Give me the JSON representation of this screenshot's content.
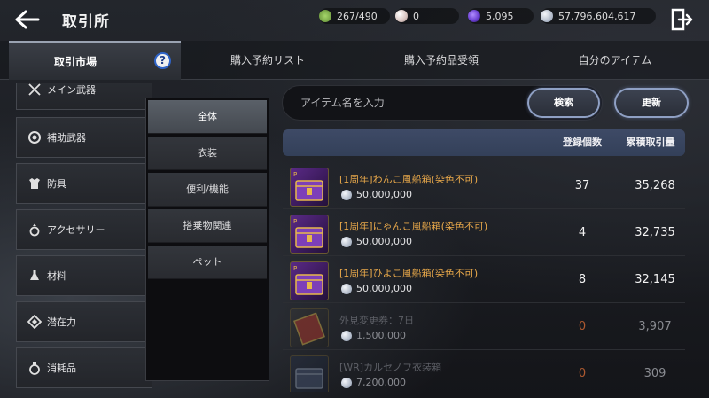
{
  "header": {
    "title": "取引所",
    "resources": [
      {
        "icon": "bag-capacity-icon",
        "value": "267/490",
        "color": "#7fb04a"
      },
      {
        "icon": "pearl-icon",
        "value": "0",
        "color": "#d8c4c0"
      },
      {
        "icon": "energy-orb-icon",
        "value": "5,095",
        "color": "#6a3fd0"
      },
      {
        "icon": "silver-coin-icon",
        "value": "57,796,604,617",
        "color": "#aab4c4"
      }
    ]
  },
  "tabs": [
    {
      "label": "取引市場"
    },
    {
      "label": "購入予約リスト"
    },
    {
      "label": "購入予約品受領"
    },
    {
      "label": "自分のアイテム"
    }
  ],
  "help_label": "?",
  "categories": [
    {
      "label": "メイン武器",
      "icon": "crossed-swords-icon"
    },
    {
      "label": "補助武器",
      "icon": "shield-ring-icon"
    },
    {
      "label": "防具",
      "icon": "armor-icon"
    },
    {
      "label": "アクセサリー",
      "icon": "ring-icon"
    },
    {
      "label": "材料",
      "icon": "flask-icon"
    },
    {
      "label": "潜在力",
      "icon": "diamond-icon"
    },
    {
      "label": "消耗品",
      "icon": "potion-icon"
    }
  ],
  "subcategories": [
    {
      "label": "全体"
    },
    {
      "label": "衣装"
    },
    {
      "label": "便利/機能"
    },
    {
      "label": "搭乗物関連"
    },
    {
      "label": "ペット"
    }
  ],
  "search": {
    "placeholder": "アイテム名を入力",
    "search_label": "検索",
    "refresh_label": "更新"
  },
  "table": {
    "col_count": "登録個数",
    "col_cumulative": "累積取引量",
    "rows": [
      {
        "name": "[1周年]わんこ風船箱(染色不可)",
        "price": "50,000,000",
        "count": "37",
        "cumulative": "35,268",
        "state": "active",
        "thumb": "purple-chest"
      },
      {
        "name": "[1周年]にゃんこ風船箱(染色不可)",
        "price": "50,000,000",
        "count": "4",
        "cumulative": "32,735",
        "state": "active",
        "thumb": "purple-chest"
      },
      {
        "name": "[1周年]ひよこ風船箱(染色不可)",
        "price": "50,000,000",
        "count": "8",
        "cumulative": "32,145",
        "state": "active",
        "thumb": "purple-chest"
      },
      {
        "name": "外見変更券：7日",
        "price": "1,500,000",
        "count": "0",
        "cumulative": "3,907",
        "state": "inactive",
        "thumb": "ticket"
      },
      {
        "name": "[WR]カルセノフ衣装箱",
        "price": "7,200,000",
        "count": "0",
        "cumulative": "309",
        "state": "inactive",
        "thumb": "blue-chest"
      }
    ]
  }
}
